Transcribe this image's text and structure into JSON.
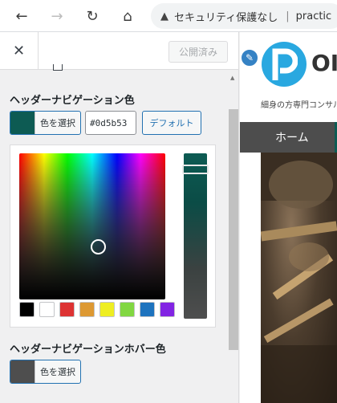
{
  "browser": {
    "back_icon": "←",
    "forward_icon": "→",
    "reload_icon": "↻",
    "home_icon": "⌂",
    "warning_icon": "▲",
    "security_text": "セキュリティ保護なし",
    "separator": "|",
    "url_text": "practic"
  },
  "customizer": {
    "close_icon": "✕",
    "publish_label": "公開済み",
    "nav_color": {
      "label": "ヘッダーナビゲーション色",
      "select_label": "色を選択",
      "hex_value": "#0d5b53",
      "default_label": "デフォルト",
      "swatch_color": "#0d5b53"
    },
    "palette": [
      "#000000",
      "#ffffff",
      "#dd3333",
      "#dd9933",
      "#eeee22",
      "#81d742",
      "#1e73be",
      "#8224e3"
    ],
    "hover_color": {
      "label": "ヘッダーナビゲーションホバー色",
      "select_label": "色を選択",
      "swatch_color": "#4e4e4e"
    }
  },
  "preview": {
    "pencil_icon": "✎",
    "logo_text": "OI",
    "tagline": "細身の方専門コンサル",
    "nav_home": "ホーム",
    "nav_color": "#0d5b53",
    "nav_hover_color": "#4d4d4d"
  }
}
